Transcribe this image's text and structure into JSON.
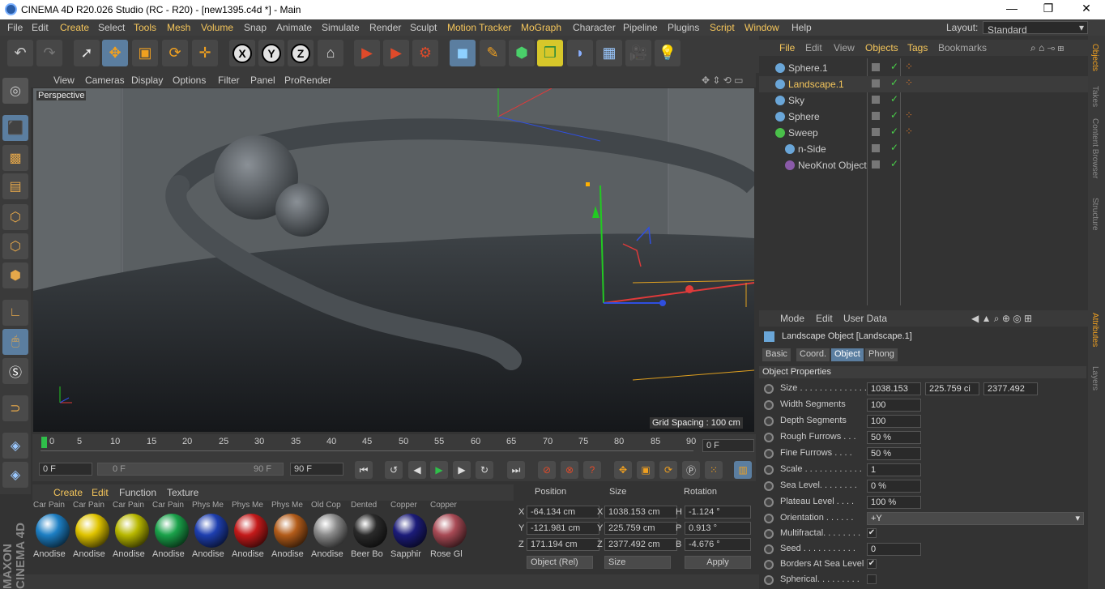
{
  "window": {
    "title": "CINEMA 4D R20.026 Studio (RC - R20) - [new1395.c4d *] - Main",
    "minimize": "—",
    "restore": "❐",
    "close": "✕"
  },
  "menubar": {
    "items": [
      "File",
      "Edit",
      "Create",
      "Select",
      "Tools",
      "Mesh",
      "Volume",
      "Snap",
      "Animate",
      "Simulate",
      "Render",
      "Sculpt",
      "Motion Tracker",
      "MoGraph",
      "Character",
      "Pipeline",
      "Plugins",
      "Script",
      "Window",
      "Help"
    ],
    "layout_label": "Layout:",
    "layout_value": "Standard"
  },
  "toolbar": {
    "x": "X",
    "y": "Y",
    "z": "Z"
  },
  "viewport": {
    "menu": [
      "View",
      "Cameras",
      "Display",
      "Options",
      "Filter",
      "Panel",
      "ProRender"
    ],
    "label": "Perspective",
    "grid_spacing": "Grid Spacing : 100 cm"
  },
  "timeline": {
    "ticks": [
      "0",
      "5",
      "10",
      "15",
      "20",
      "25",
      "30",
      "35",
      "40",
      "45",
      "50",
      "55",
      "60",
      "65",
      "70",
      "75",
      "80",
      "85",
      "90"
    ],
    "current_frame": "0 F",
    "start": "0 F",
    "range_start": "0 F",
    "range_end": "90 F",
    "end": "90 F"
  },
  "materials": {
    "menu": [
      "Create",
      "Edit",
      "Function",
      "Texture"
    ],
    "items": [
      {
        "top": "Car Pain",
        "name": "Anodise",
        "color": "#1d7fc4"
      },
      {
        "top": "Car Pain",
        "name": "Anodise",
        "color": "#e0c400"
      },
      {
        "top": "Car Pain",
        "name": "Anodise",
        "color": "#b8b800"
      },
      {
        "top": "Car Pain",
        "name": "Anodise",
        "color": "#1aa24a"
      },
      {
        "top": "Phys Me",
        "name": "Anodise",
        "color": "#1e3fb0"
      },
      {
        "top": "Phys Me",
        "name": "Anodise",
        "color": "#c41a1a"
      },
      {
        "top": "Phys Me",
        "name": "Anodise",
        "color": "#b35c1a"
      },
      {
        "top": "Old Cop",
        "name": "Anodise",
        "color": "#8a8a8a"
      },
      {
        "top": "Dented",
        "name": "Beer Bo",
        "color": "#2a2a2a"
      },
      {
        "top": "Copper",
        "name": "Sapphir",
        "color": "#1c1c7a"
      },
      {
        "top": "Copper",
        "name": "Rose Gl",
        "color": "#a84a55"
      }
    ]
  },
  "coords": {
    "headers": {
      "position": "Position",
      "size": "Size",
      "rotation": "Rotation"
    },
    "axis": [
      "X",
      "Y",
      "Z"
    ],
    "rot_axis": [
      "H",
      "P",
      "B"
    ],
    "position": [
      "-64.134 cm",
      "-121.981 cm",
      "171.194 cm"
    ],
    "size": [
      "1038.153 cm",
      "225.759 cm",
      "2377.492 cm"
    ],
    "rotation": [
      "-1.124 °",
      "0.913 °",
      "-4.676 °"
    ],
    "mode": "Object (Rel)",
    "size_mode": "Size",
    "apply": "Apply"
  },
  "objects": {
    "menu": [
      "File",
      "Edit",
      "View",
      "Objects",
      "Tags",
      "Bookmarks"
    ],
    "items": [
      {
        "name": "Sphere.1",
        "color": "#6aa6d8"
      },
      {
        "name": "Landscape.1",
        "color": "#6aa6d8"
      },
      {
        "name": "Sky",
        "color": "#6aa6d8"
      },
      {
        "name": "Sphere",
        "color": "#6aa6d8"
      },
      {
        "name": "Sweep",
        "color": "#4ac04a"
      },
      {
        "name": "n-Side",
        "color": "#6aa6d8"
      },
      {
        "name": "NeoKnot Object",
        "color": "#8a5aa8"
      }
    ]
  },
  "attributes": {
    "menu": [
      "Mode",
      "Edit",
      "User Data"
    ],
    "object_title": "Landscape Object [Landscape.1]",
    "tabs": [
      "Basic",
      "Coord.",
      "Object",
      "Phong"
    ],
    "section": "Object Properties",
    "size_label": "Size . . . . . . . . . . . . . .",
    "size_values": [
      "1038.153",
      "225.759 ci",
      "2377.492"
    ],
    "rows": [
      {
        "label": "Width Segments",
        "value": "100"
      },
      {
        "label": "Depth Segments",
        "value": "100"
      },
      {
        "label": "Rough Furrows . . .",
        "value": "50 %"
      },
      {
        "label": "Fine Furrows . . . .",
        "value": "50 %"
      },
      {
        "label": "Scale . . . . . . . . . . . .",
        "value": "1"
      },
      {
        "label": "Sea Level. . . . . . . .",
        "value": "0 %"
      },
      {
        "label": "Plateau Level . . . .",
        "value": "100 %"
      }
    ],
    "orientation_label": "Orientation . . . . . .",
    "orientation_value": "+Y",
    "multifractal_label": "Multifractal. . . . . . . .",
    "seed_label": "Seed . . . . . . . . . . .",
    "seed_value": "0",
    "borders_label": "Borders At Sea Level",
    "spherical_label": "Spherical. . . . . . . . ."
  },
  "side_tabs": [
    "Objects",
    "Takes",
    "Content Browser",
    "Structure",
    "Attributes",
    "Layers"
  ],
  "brand": "MAXON CINEMA 4D"
}
